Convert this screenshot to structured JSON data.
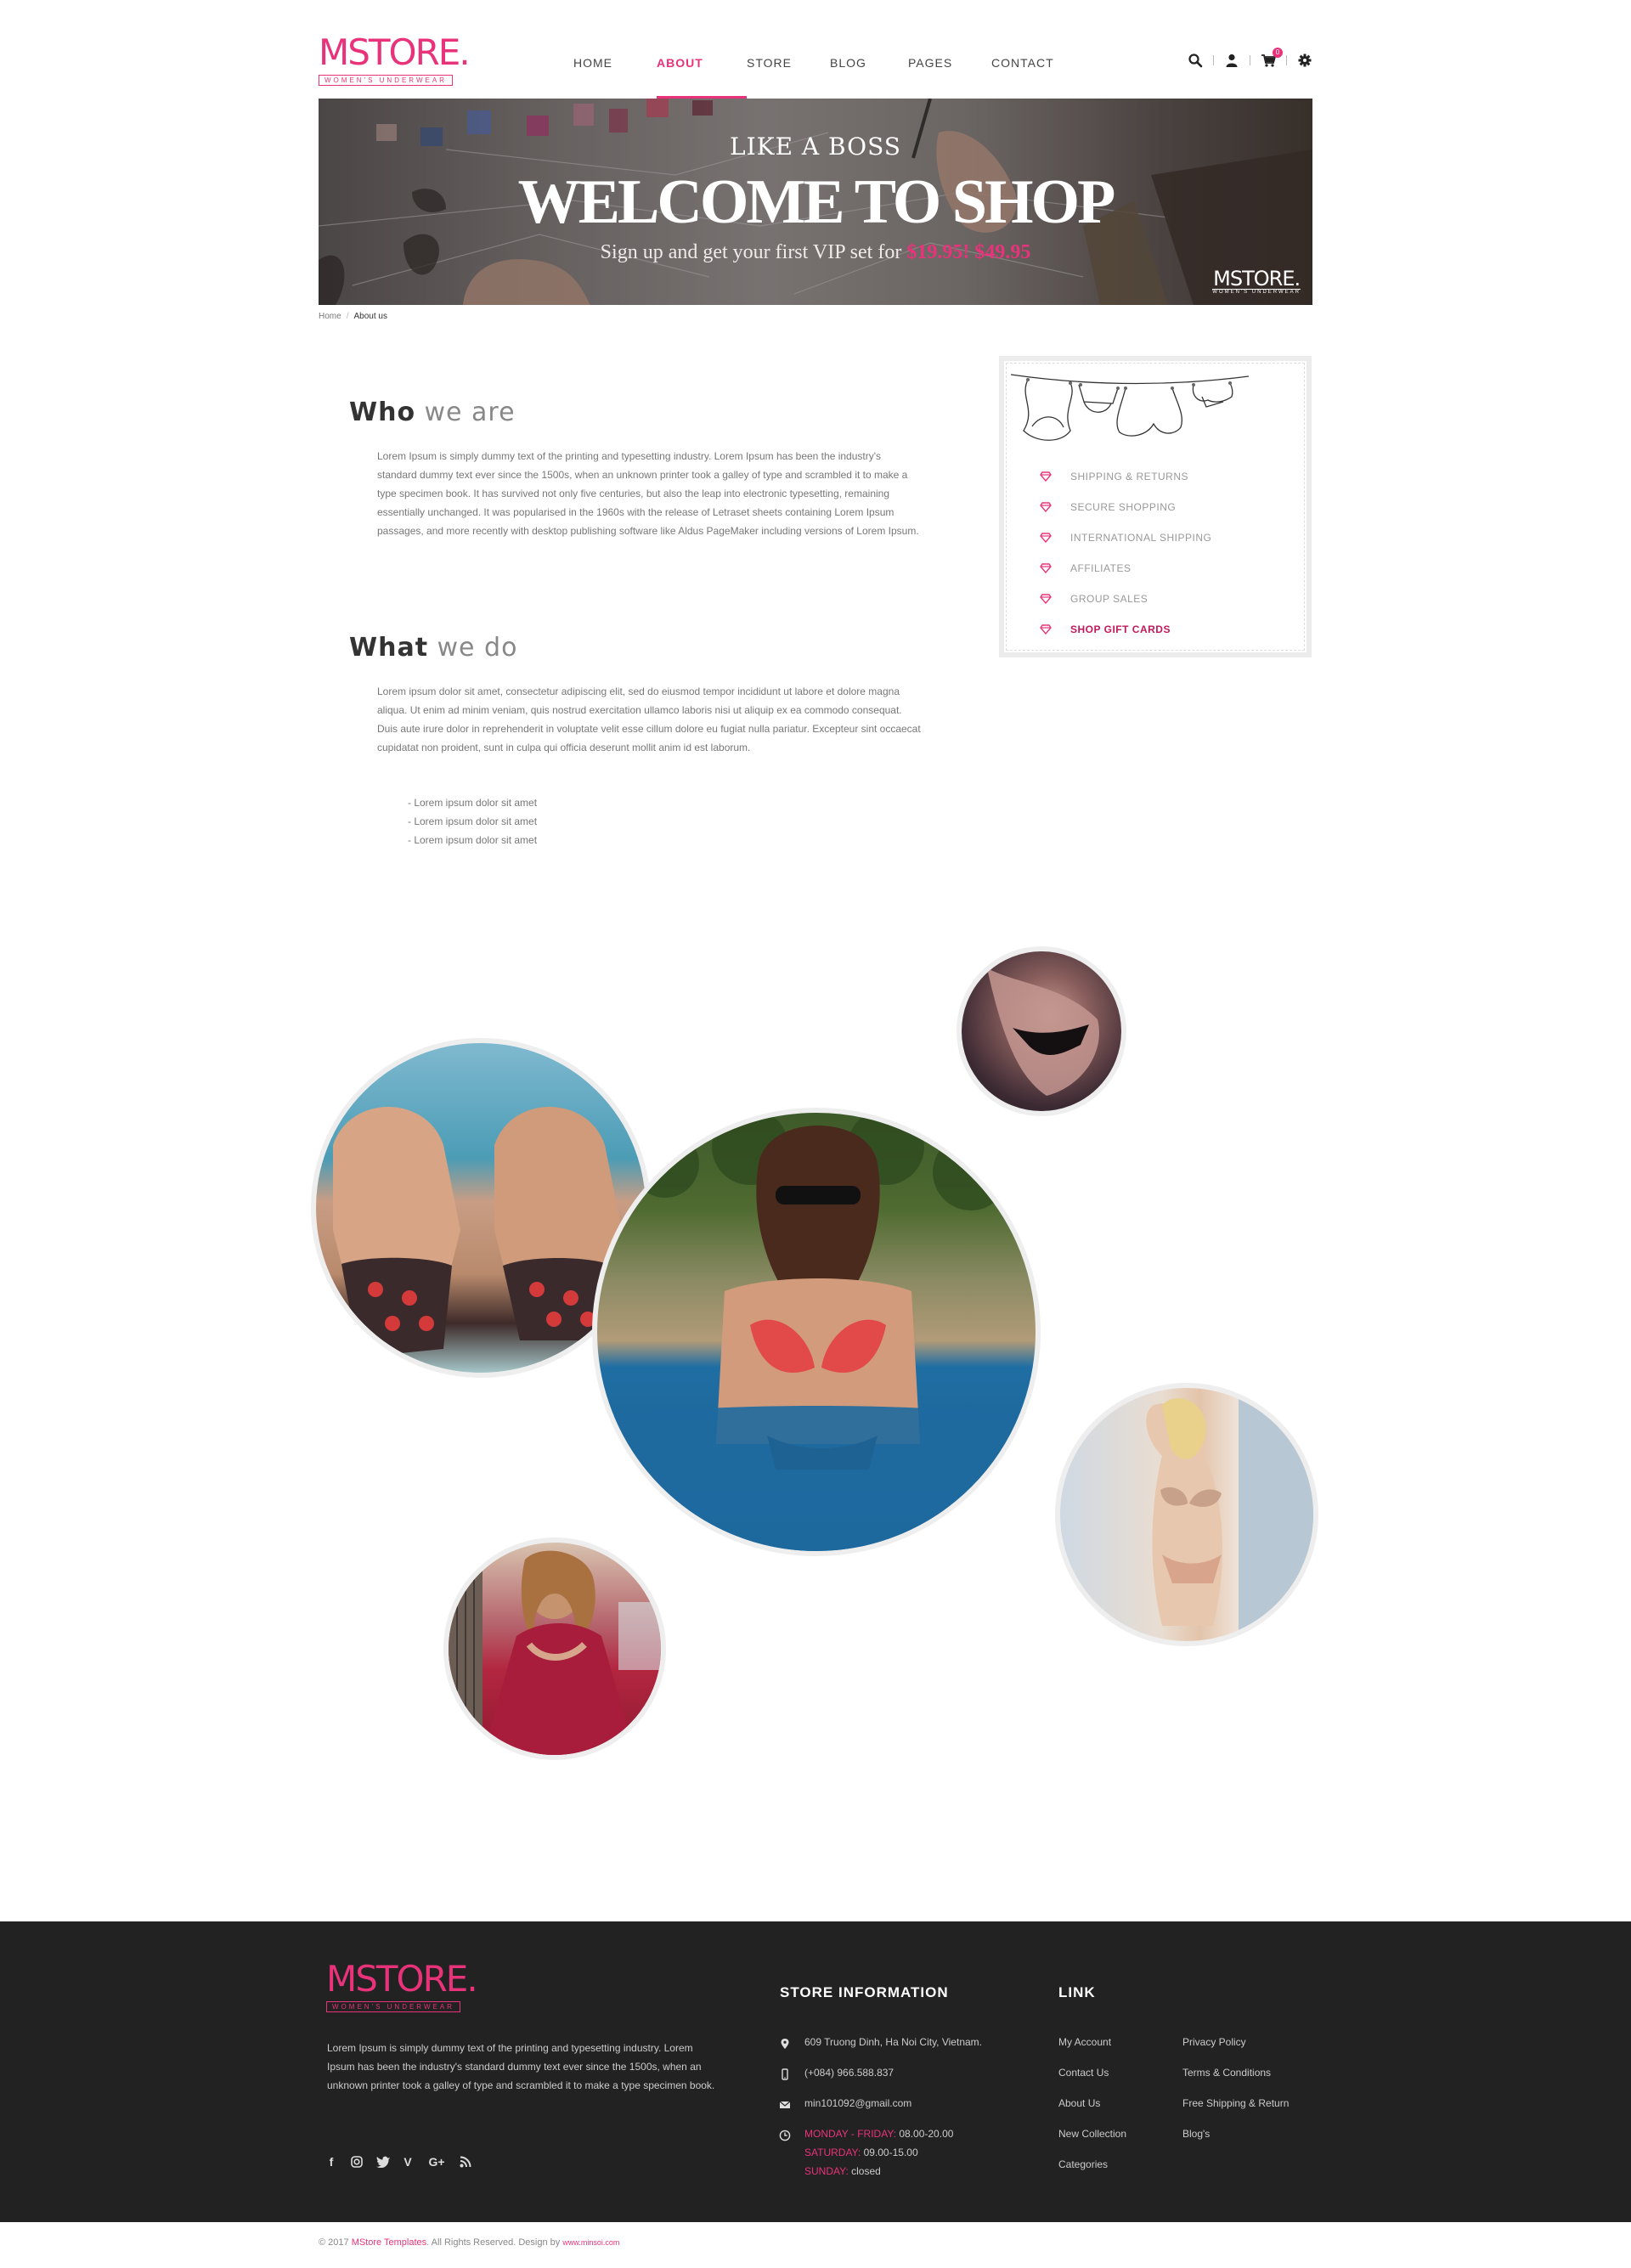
{
  "header": {
    "logo_word": "MSTORE",
    "logo_sub": "WOMEN'S UNDERWEAR",
    "nav": [
      {
        "label": "HOME",
        "active": false
      },
      {
        "label": "ABOUT",
        "active": true
      },
      {
        "label": "STORE",
        "active": false
      },
      {
        "label": "BLOG",
        "active": false
      },
      {
        "label": "PAGES",
        "active": false
      },
      {
        "label": "CONTACT",
        "active": false
      }
    ],
    "cart_count": "0",
    "icons": [
      "search-icon",
      "user-icon",
      "cart-icon",
      "gear-icon"
    ],
    "accent_color": "#e8337a"
  },
  "banner": {
    "kicker": "LIKE A BOSS",
    "title": "WELCOME TO SHOP",
    "subtitle_prefix": "Sign up and get your first VIP set for",
    "price_1": "$19.95!",
    "price_2": "$49.95",
    "logo_word": "MSTORE",
    "logo_sub": "WOMEN'S UNDERWEAR"
  },
  "breadcrumb": {
    "home": "Home",
    "separator": "/",
    "current": "About us"
  },
  "who": {
    "title_bold": "Who",
    "title_light": "we are",
    "text": "Lorem Ipsum is simply dummy text of the printing and typesetting industry. Lorem Ipsum has been the industry's standard dummy text ever since the 1500s, when an unknown printer took a galley of type and scrambled it to make a type specimen book. It has survived not only five centuries, but also the leap into electronic typesetting, remaining essentially unchanged. It was popularised in the 1960s with the release of Letraset sheets containing Lorem Ipsum passages, and more recently with desktop publishing software like Aldus PageMaker including versions of Lorem Ipsum."
  },
  "what": {
    "title_bold": "What",
    "title_light": "we do",
    "text": "Lorem ipsum dolor sit amet, consectetur adipiscing elit, sed do eiusmod tempor incididunt ut labore et dolore magna aliqua. Ut enim ad minim veniam, quis nostrud exercitation ullamco laboris nisi ut aliquip ex ea commodo consequat. Duis aute irure dolor in reprehenderit in voluptate velit esse cillum dolore eu fugiat nulla pariatur. Excepteur sint occaecat cupidatat non proident, sunt in culpa qui officia deserunt mollit anim id est laborum.",
    "bullets": [
      "- Lorem ipsum dolor sit amet",
      "- Lorem ipsum dolor sit amet",
      "- Lorem ipsum dolor sit amet"
    ]
  },
  "sidebar": {
    "links": [
      {
        "label": "SHIPPING & RETURNS",
        "highlight": false
      },
      {
        "label": "SECURE SHOPPING",
        "highlight": false
      },
      {
        "label": "INTERNATIONAL SHIPPING",
        "highlight": false
      },
      {
        "label": "AFFILIATES",
        "highlight": false
      },
      {
        "label": "GROUP SALES",
        "highlight": false
      },
      {
        "label": "SHOP GIFT CARDS",
        "highlight": true
      }
    ]
  },
  "footer": {
    "logo_word": "MSTORE",
    "logo_sub": "WOMEN'S UNDERWEAR",
    "about": "Lorem Ipsum is simply dummy text of the printing and typesetting industry. Lorem Ipsum has been the industry's standard dummy text ever since the 1500s, when an unknown printer took a galley of type and scrambled it to make a type specimen book.",
    "socials": [
      "facebook-icon",
      "instagram-icon",
      "twitter-icon",
      "vimeo-icon",
      "google-plus-icon",
      "rss-icon"
    ],
    "store_info_title": "STORE INFORMATION",
    "address": "609 Truong Dinh, Ha Noi City, Vietnam.",
    "phone": "(+084) 966.588.837",
    "email": "min101092@gmail.com",
    "hours": {
      "weekday_label": "MONDAY - FRIDAY:",
      "weekday_value": "08.00-20.00",
      "sat_label": "SATURDAY:",
      "sat_value": "09.00-15.00",
      "sun_label": "SUNDAY:",
      "sun_value": "closed"
    },
    "link_title": "LINK",
    "links_col1": [
      "My Account",
      "Contact Us",
      "About Us",
      "New Collection",
      "Categories"
    ],
    "links_col2": [
      "Privacy Policy",
      "Terms & Conditions",
      "Free Shipping & Return",
      "Blog's"
    ],
    "copyright_prefix": "© 2017",
    "copyright_brand": "MStore Templates",
    "copyright_mid": ". All Rights Reserved. Design by",
    "copyright_site": "www.minsoi.com"
  }
}
